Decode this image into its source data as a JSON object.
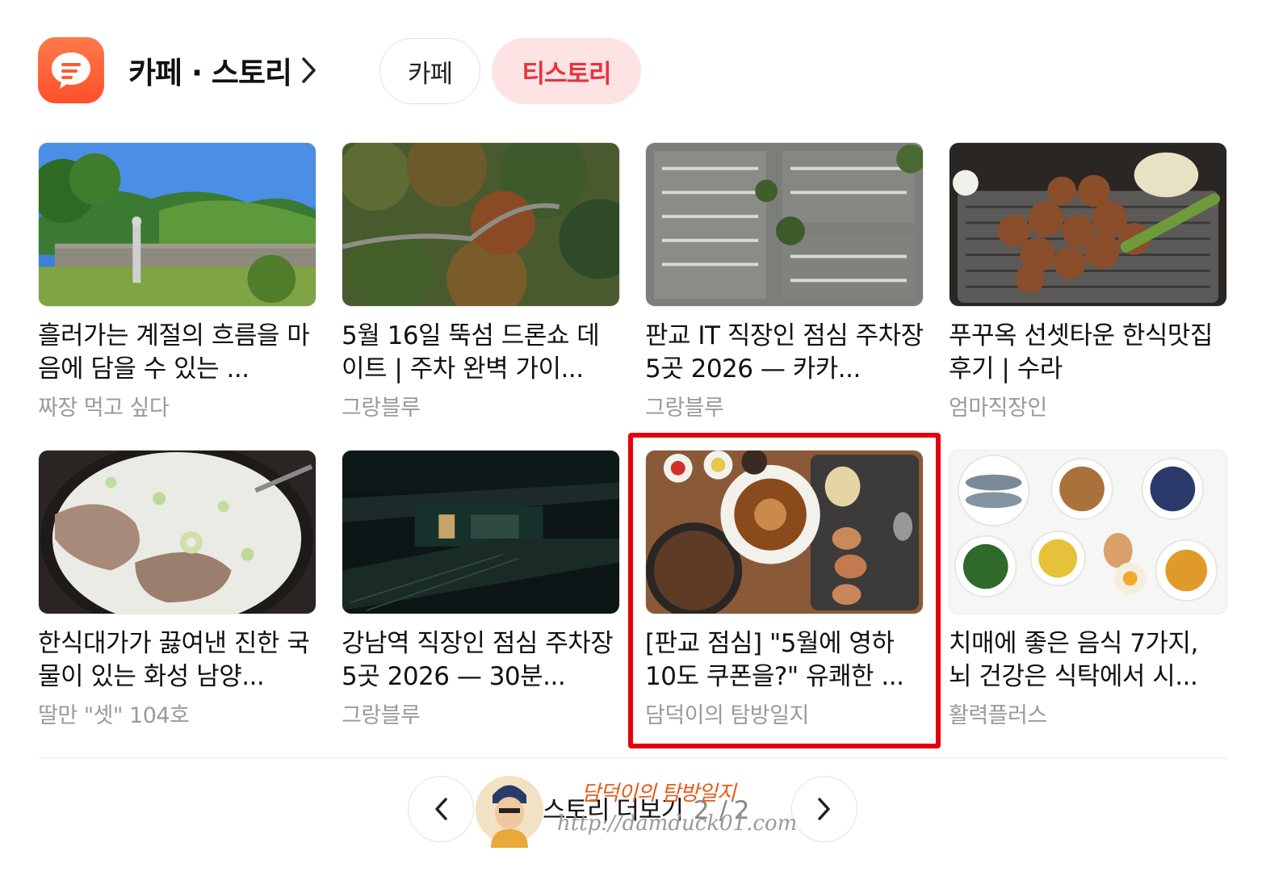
{
  "header": {
    "title": "카페 · 스토리",
    "tabs": [
      {
        "label": "카페",
        "active": false
      },
      {
        "label": "티스토리",
        "active": true
      }
    ],
    "accent_color": "#ff5a33"
  },
  "cards": [
    {
      "title": "흘러가는 계절의 흐름을 마음에 담을 수 있는 ...",
      "source": "짜장 먹고 싶다"
    },
    {
      "title": "5월 16일 뚝섬 드론쇼 데이트 | 주차 완벽 가이...",
      "source": "그랑블루"
    },
    {
      "title": "판교 IT 직장인 점심 주차장 5곳 2026 — 카카...",
      "source": "그랑블루"
    },
    {
      "title": "푸꾸옥 선셋타운 한식맛집 후기 | 수라",
      "source": "엄마직장인"
    },
    {
      "title": "한식대가가 끓여낸 진한 국물이 있는 화성 남양...",
      "source": "딸만 \"셋\" 104호"
    },
    {
      "title": "강남역 직장인 점심 주차장 5곳 2026 — 30분...",
      "source": "그랑블루"
    },
    {
      "title": "[판교 점심] \"5월에 영하 10도 쿠폰을?\" 유쾌한 ...",
      "source": "담덕이의 탐방일지"
    },
    {
      "title": "치매에 좋은 음식 7가지, 뇌 건강은 식탁에서 시...",
      "source": "활력플러스"
    }
  ],
  "pager": {
    "label": "스토리 더보기",
    "current": "2",
    "total": "/ 2"
  },
  "watermark": {
    "title": "담덕이의 탐방일지",
    "url": "http://damduck01.com"
  },
  "highlight_color": "#e6000e"
}
